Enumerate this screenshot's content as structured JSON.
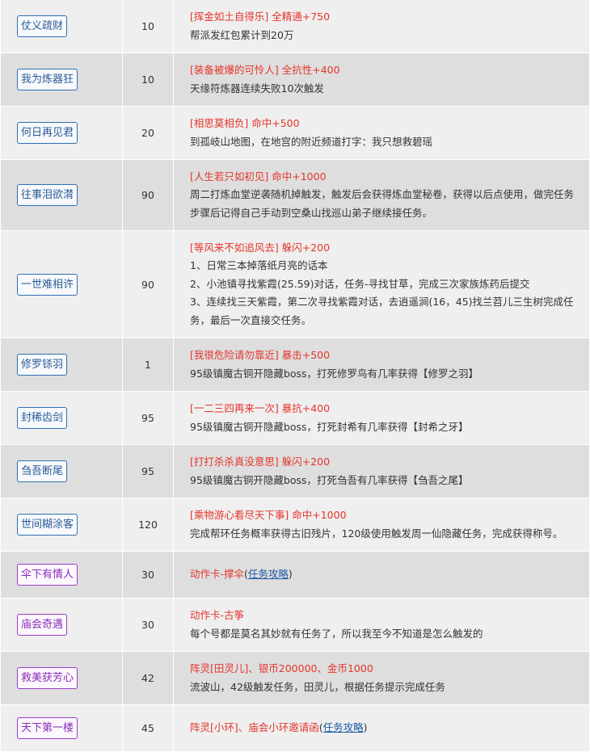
{
  "rows": [
    {
      "title": "仗义疏财",
      "level": "10",
      "title_style": "blue",
      "reward_name": "[挥金如土自得乐]",
      "reward_bonus": "全精通+750",
      "desc": [
        "帮派发红包累计到20万"
      ]
    },
    {
      "title": "我为炼器狂",
      "level": "10",
      "title_style": "blue",
      "reward_name": "[装备被爆的可怜人]",
      "reward_bonus": "全抗性+400",
      "desc": [
        "天缘符炼器连续失败10次触发"
      ]
    },
    {
      "title": "何日再见君",
      "level": "20",
      "title_style": "blue",
      "reward_name": "[相思莫相负]",
      "reward_bonus": "命中+500",
      "desc": [
        "到孤岐山地图，在地宫的附近频道打字：我只想救碧瑶"
      ]
    },
    {
      "title": "往事泪欲潸",
      "level": "90",
      "title_style": "blue",
      "reward_name": "[人生若只如初见]",
      "reward_bonus": "命中+1000",
      "desc": [
        "周二打炼血堂逆袭随机掉触发，触发后会获得炼血堂秘卷，获得以后点使用，做完任务步骤后记得自己手动到空桑山找巡山弟子继续接任务。"
      ]
    },
    {
      "title": "一世难相许",
      "level": "90",
      "title_style": "blue",
      "reward_name": "[等风来不如追风去]",
      "reward_bonus": "躲闪+200",
      "desc": [
        "1、日常三本掉落纸月亮的话本",
        "2、小池镇寻找紫霞(25.59)对话，任务-寻找甘草，完成三次家族炼药后提交",
        "3、连续找三天紫霞，第二次寻找紫霞对话，去逍遥涧(16，45)找兰苕儿三生树完成任务，最后一次直接交任务。"
      ]
    },
    {
      "title": "修罗铩羽",
      "level": "1",
      "title_style": "blue",
      "reward_name": "[我很危险请勿靠近]",
      "reward_bonus": "暴击+500",
      "desc": [
        "95级镇魔古铜开隐藏boss，打死修罗鸟有几率获得【修罗之羽】"
      ]
    },
    {
      "title": "封稀齿剑",
      "level": "95",
      "title_style": "blue",
      "reward_name": "[一二三四再来一次]",
      "reward_bonus": "暴抗+400",
      "desc": [
        "95级镇魔古铜开隐藏boss，打死封希有几率获得【封希之牙】"
      ]
    },
    {
      "title": "刍吾断尾",
      "level": "95",
      "title_style": "blue",
      "reward_name": "[打打杀杀真没意思]",
      "reward_bonus": "躲闪+200",
      "desc": [
        "95级镇魔古铜开隐藏boss，打死刍吾有几率获得【刍吾之尾】"
      ]
    },
    {
      "title": "世间糊涂客",
      "level": "120",
      "title_style": "blue",
      "reward_name": "[乘物游心看尽天下事]",
      "reward_bonus": "命中+1000",
      "desc": [
        "完成帮环任务概率获得古旧残片，120级使用触发周一仙隐藏任务，完成获得称号。"
      ]
    },
    {
      "title": "伞下有情人",
      "level": "30",
      "title_style": "purple",
      "reward_line": "动作卡-撑伞",
      "link_open": "(",
      "link_text": "任务攻略",
      "link_close": ")",
      "desc": []
    },
    {
      "title": "庙会奇遇",
      "level": "30",
      "title_style": "purple",
      "reward_line": "动作卡-古筝",
      "desc": [
        "每个号都是莫名其妙就有任务了，所以我至今不知道是怎么触发的"
      ]
    },
    {
      "title": "救美获芳心",
      "level": "42",
      "title_style": "purple",
      "reward_line": "阵灵[田灵儿]、银币200000、金币1000",
      "desc": [
        "流波山，42级触发任务，田灵儿，根据任务提示完成任务"
      ]
    },
    {
      "title": "天下第一楼",
      "level": "45",
      "title_style": "purple",
      "reward_line": "阵灵[小环]、庙会小环邀请函",
      "link_open": "(",
      "link_text": "任务攻略",
      "link_close": ")",
      "desc": []
    }
  ],
  "colors": {
    "accent_red": "#e5352b",
    "badge_blue": "#2f6fb5",
    "badge_purple": "#9a3dc7",
    "link": "#1f5aa6"
  }
}
